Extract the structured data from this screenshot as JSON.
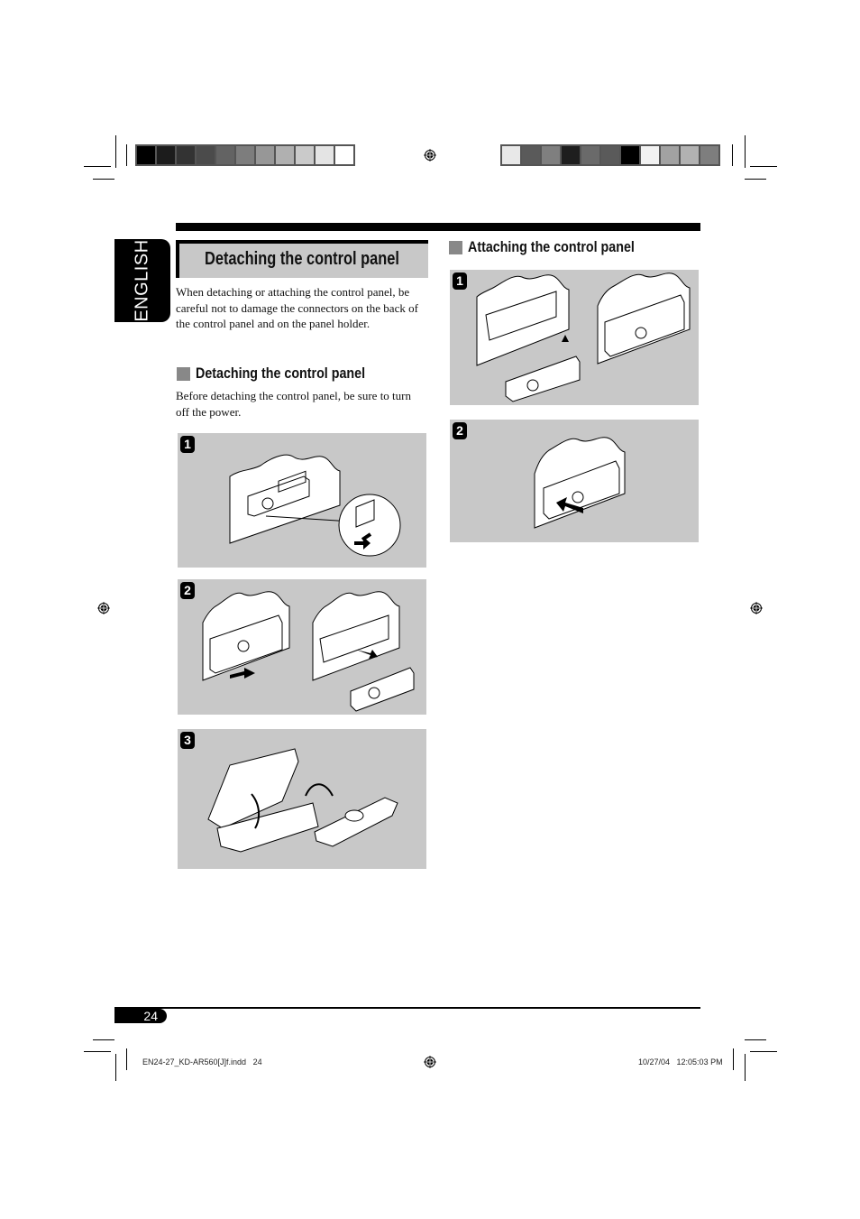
{
  "header": {
    "color_bar_left": [
      "#000000",
      "#1c1c1c",
      "#333333",
      "#4b4b4b",
      "#636363",
      "#7d7d7d",
      "#979797",
      "#b0b0b0",
      "#cacaca",
      "#e4e4e4",
      "#ffffff"
    ],
    "color_bar_right": [
      "#e8e8e8",
      "#5a5a5a",
      "#7f7f7f",
      "#1e1e1e",
      "#6a6a6a",
      "#5a5a5a",
      "#000000",
      "#f2f2f2",
      "#a2a2a2",
      "#b2b2b2",
      "#7e7e7e"
    ]
  },
  "language_tab": "ENGLISH",
  "main": {
    "title": "Detaching the control panel",
    "intro": "When detaching or attaching the control panel, be careful not to damage the connectors on the back of the control panel and on the panel holder.",
    "detach_section": {
      "heading": "Detaching the control panel",
      "text": "Before detaching the control panel, be sure to turn off the power.",
      "steps": [
        {
          "number": "1",
          "illustration": "press-release-button"
        },
        {
          "number": "2",
          "illustration": "pull-out-panel"
        },
        {
          "number": "3",
          "illustration": "store-in-case"
        }
      ]
    },
    "attach_section": {
      "heading": "Attaching the control panel",
      "steps": [
        {
          "number": "1",
          "illustration": "align-panel-connector"
        },
        {
          "number": "2",
          "illustration": "push-panel-in"
        }
      ]
    }
  },
  "footer": {
    "page_number": "24",
    "file_slug": "EN24-27_KD-AR560[J]f.indd   24",
    "timestamp": "10/27/04   12:05:03 PM"
  }
}
